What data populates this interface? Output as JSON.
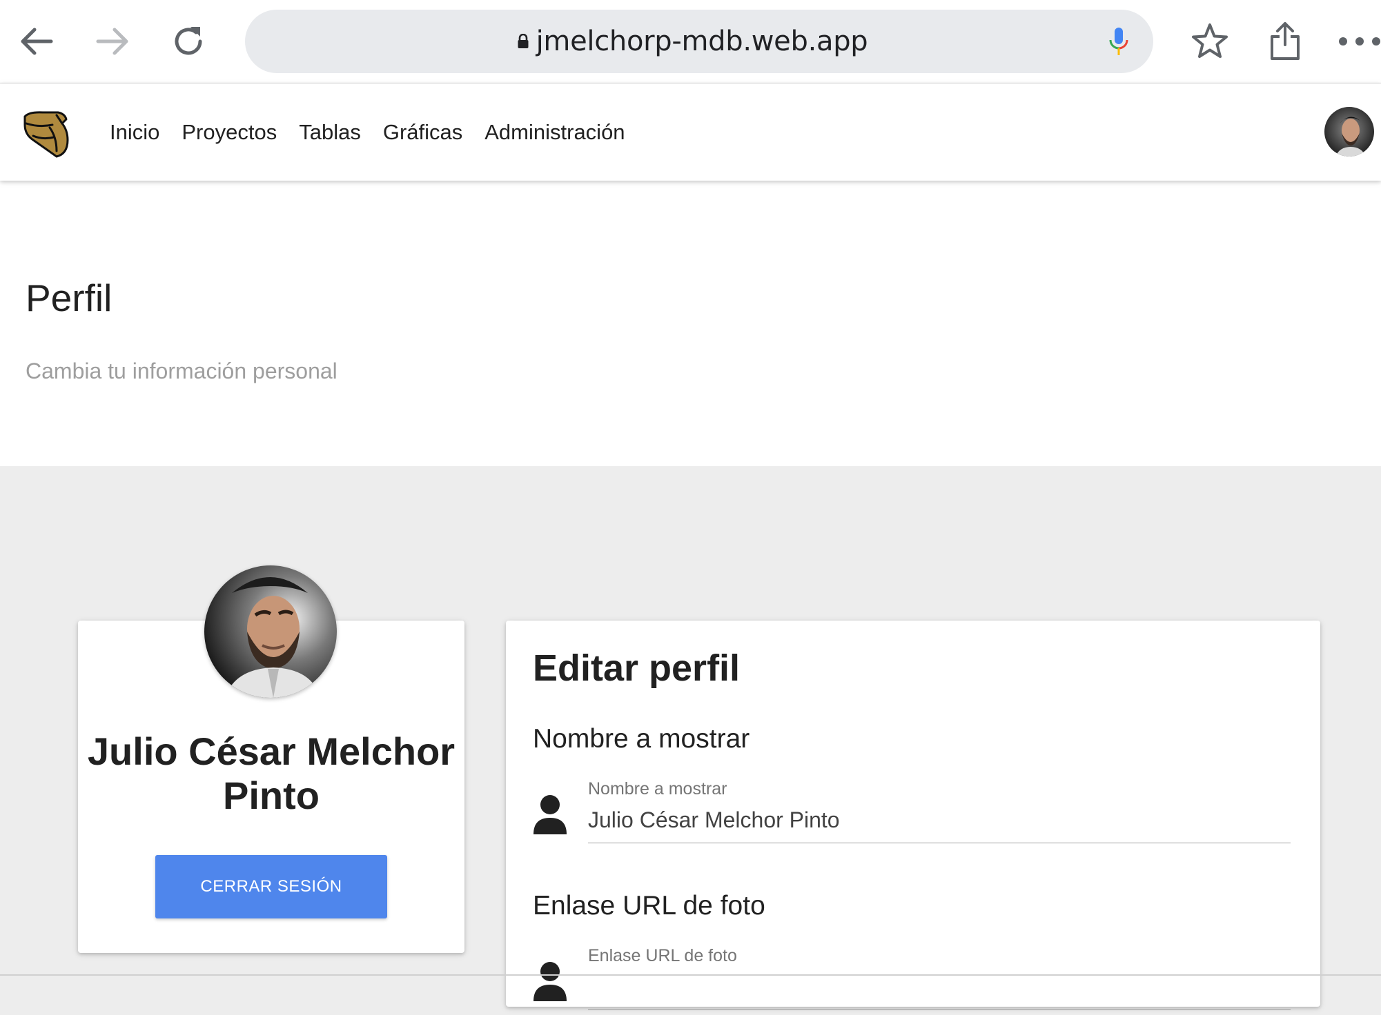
{
  "browser": {
    "url": "jmelchorp-mdb.web.app",
    "back_icon": "arrow-left-icon",
    "forward_icon": "arrow-right-icon",
    "reload_icon": "reload-icon",
    "lock_icon": "lock-icon",
    "mic_icon": "microphone-icon",
    "bookmark_icon": "star-icon",
    "share_icon": "share-icon",
    "menu_icon": "more-horizontal-icon"
  },
  "navbar": {
    "logo_icon": "brand-logo-icon",
    "links": [
      "Inicio",
      "Proyectos",
      "Tablas",
      "Gráficas",
      "Administración"
    ],
    "avatar": "user-avatar"
  },
  "header": {
    "title": "Perfil",
    "subtitle": "Cambia tu información personal"
  },
  "profile_card": {
    "name": "Julio César Melchor Pinto",
    "logout_label": "CERRAR SESIÓN"
  },
  "edit_card": {
    "title": "Editar perfil",
    "display_name_section": "Nombre a mostrar",
    "display_name_label": "Nombre a mostrar",
    "display_name_value": "Julio César Melchor Pinto",
    "photo_url_section": "Enlase URL de foto",
    "photo_url_label": "Enlase URL de foto",
    "photo_url_value": ""
  },
  "colors": {
    "primary_button": "#4f86ec",
    "page_bg": "#ededed",
    "logo_fill": "#b08a3e",
    "url_bar_bg": "#e8eaed"
  }
}
